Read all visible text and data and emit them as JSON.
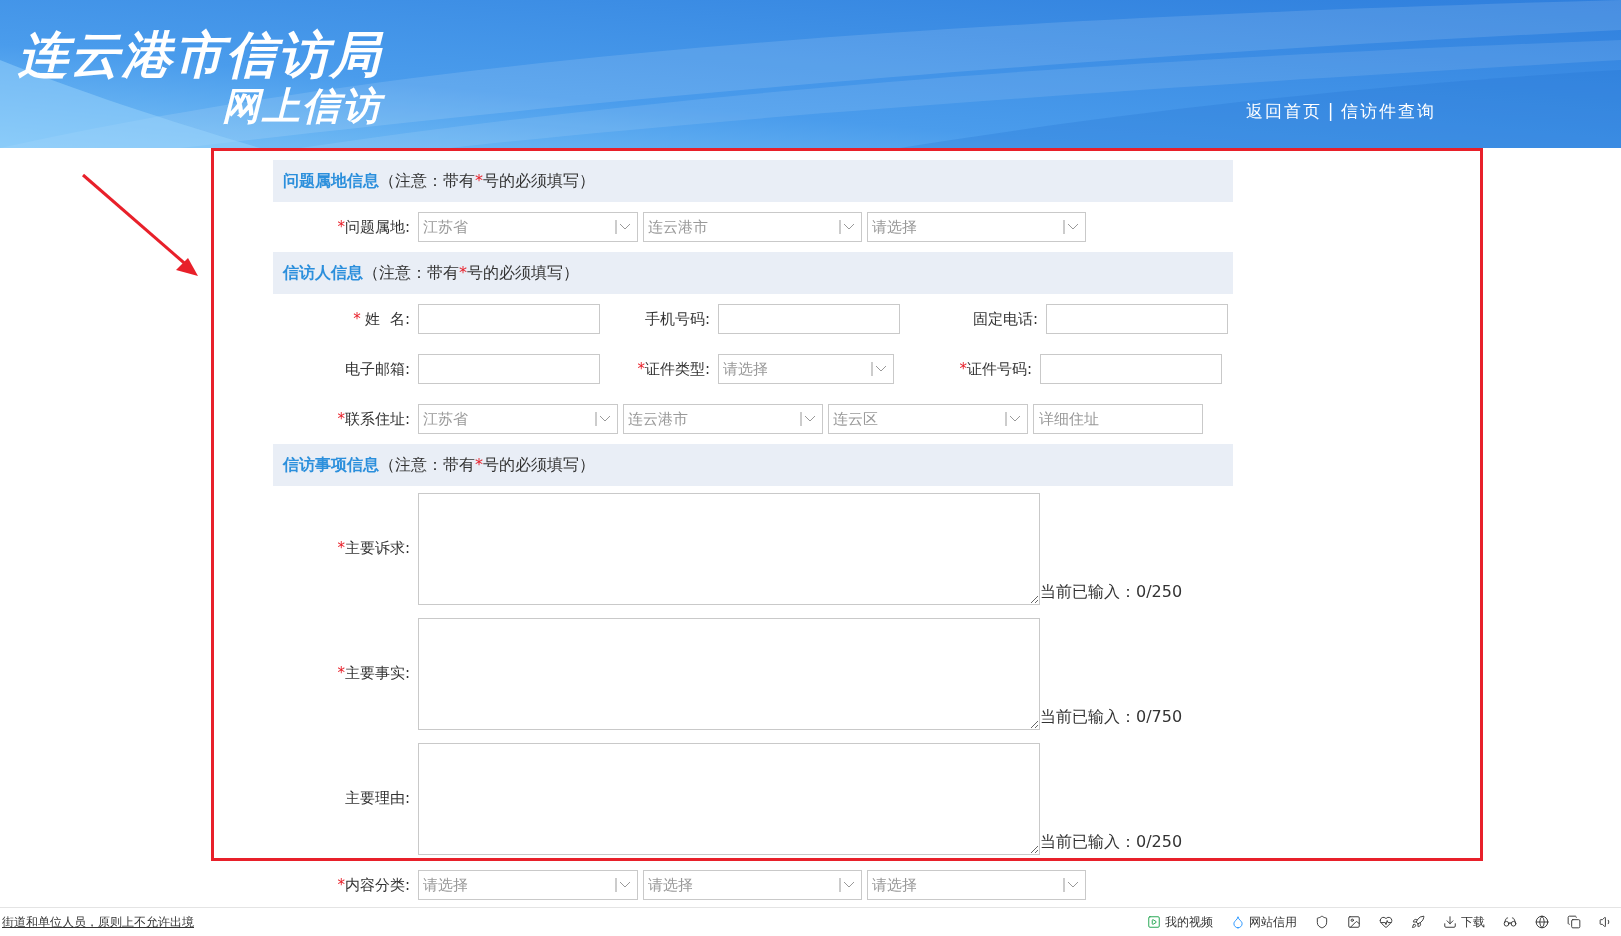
{
  "header": {
    "title": "连云港市信访局",
    "subtitle": "网上信访",
    "links": [
      {
        "label": "返回首页"
      },
      {
        "label": "信访件查询"
      }
    ],
    "separator": "|"
  },
  "sections": [
    {
      "title": "问题属地信息",
      "note_start": "（注意：带有",
      "note_mark": "*",
      "note_end": "号的必须填写）",
      "rows": [
        {
          "fields": [
            {
              "mark": "*",
              "label": "问题属地:",
              "kind": "select",
              "items": [
                {
                  "value": "江苏省"
                },
                {
                  "value": "连云港市"
                },
                {
                  "value": "请选择"
                }
              ]
            }
          ]
        }
      ]
    },
    {
      "title": "信访人信息",
      "note_start": "（注意：带有",
      "note_mark": "*",
      "note_end": "号的必须填写）",
      "rows": [
        {
          "fields": [
            {
              "mark": "* ",
              "label": "姓  名:",
              "kind": "input"
            },
            {
              "label": "手机号码:",
              "kind": "input"
            },
            {
              "label": "固定电话:",
              "kind": "input"
            }
          ]
        },
        {
          "fields": [
            {
              "label": "电子邮箱:",
              "kind": "input"
            },
            {
              "mark": "*",
              "label": "证件类型:",
              "kind": "select",
              "items": [
                {
                  "value": "请选择"
                }
              ]
            },
            {
              "mark": "*",
              "label": "证件号码:",
              "kind": "input"
            }
          ]
        },
        {
          "fields": [
            {
              "mark": "*",
              "label": "联系住址:",
              "kind": "address",
              "items": [
                {
                  "value": "江苏省"
                },
                {
                  "value": "连云港市"
                },
                {
                  "value": "连云区"
                }
              ],
              "placeholder": "详细住址"
            }
          ]
        }
      ]
    },
    {
      "title": "信访事项信息",
      "note_start": "（注意：带有",
      "note_mark": "*",
      "note_end": "号的必须填写）",
      "rows": [
        {
          "fields": [
            {
              "mark": "*",
              "label": "主要诉求:",
              "kind": "textarea",
              "counter": "当前已输入：0/250"
            }
          ]
        },
        {
          "fields": [
            {
              "mark": "*",
              "label": "主要事实:",
              "kind": "textarea",
              "counter": "当前已输入：0/750"
            }
          ]
        },
        {
          "fields": [
            {
              "label": "主要理由:",
              "kind": "textarea",
              "counter": "当前已输入：0/250"
            }
          ]
        }
      ]
    }
  ],
  "extra_row": {
    "mark": "*",
    "label": "内容分类:",
    "items": [
      {
        "value": "请选择"
      },
      {
        "value": "请选择"
      },
      {
        "value": "请选择"
      }
    ]
  },
  "status_bar": {
    "notice": "街道和单位人员，原则上不允许出境",
    "items": [
      {
        "label": "我的视频"
      },
      {
        "label": "网站信用"
      },
      {
        "label": "下载"
      }
    ]
  }
}
